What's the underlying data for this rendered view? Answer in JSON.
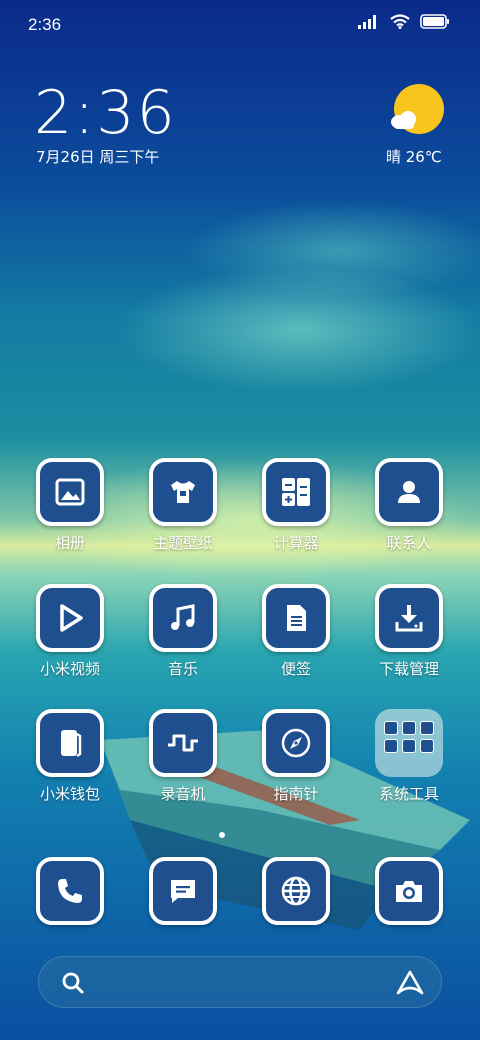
{
  "status_bar": {
    "time": "2:36",
    "icons": [
      "signal-icon",
      "wifi-icon",
      "battery-icon"
    ]
  },
  "clock_widget": {
    "time": "2:36",
    "date": "7月26日 周三下午"
  },
  "weather_widget": {
    "icon": "partly-sunny-icon",
    "text": "晴 26℃"
  },
  "apps": [
    {
      "label": "相册",
      "icon": "gallery-icon"
    },
    {
      "label": "主题壁纸",
      "icon": "tshirt-icon"
    },
    {
      "label": "计算器",
      "icon": "calculator-icon"
    },
    {
      "label": "联系人",
      "icon": "contacts-icon"
    },
    {
      "label": "小米视频",
      "icon": "play-icon"
    },
    {
      "label": "音乐",
      "icon": "music-icon"
    },
    {
      "label": "便签",
      "icon": "notes-icon"
    },
    {
      "label": "下载管理",
      "icon": "download-icon"
    },
    {
      "label": "小米钱包",
      "icon": "wallet-icon"
    },
    {
      "label": "录音机",
      "icon": "recorder-icon"
    },
    {
      "label": "指南针",
      "icon": "compass-icon"
    },
    {
      "label": "系统工具",
      "icon": "folder-icon"
    }
  ],
  "dock": [
    {
      "icon": "phone-icon"
    },
    {
      "icon": "message-icon"
    },
    {
      "icon": "browser-icon"
    },
    {
      "icon": "camera-icon"
    }
  ],
  "search_bar": {
    "left_icon": "search-icon",
    "right_icon": "assistant-icon"
  },
  "colors": {
    "icon_tile": "#1f4f8f",
    "icon_border": "#ffffff",
    "sun": "#f7c51e"
  }
}
